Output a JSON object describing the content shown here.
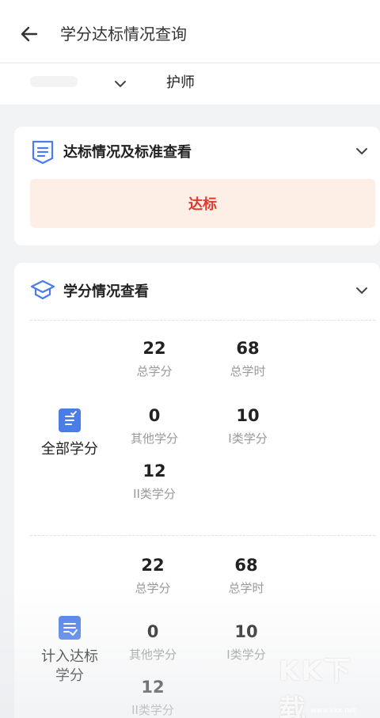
{
  "header": {
    "title": "学分达标情况查询"
  },
  "selector": {
    "value": "护师"
  },
  "standard_card": {
    "title": "达标情况及标准查看",
    "status": "达标",
    "status_color": "#e03a2f"
  },
  "credit_card": {
    "title": "学分情况查看",
    "sections": [
      {
        "label": "全部学分",
        "stats": [
          {
            "value": "22",
            "label": "总学分"
          },
          {
            "value": "68",
            "label": "总学时"
          },
          {
            "value": "0",
            "label": "其他学分"
          },
          {
            "value": "10",
            "label": "I类学分"
          },
          {
            "value": "12",
            "label": "II类学分"
          }
        ]
      },
      {
        "label_line1": "计入达标",
        "label_line2": "学分",
        "stats": [
          {
            "value": "22",
            "label": "总学分"
          },
          {
            "value": "68",
            "label": "总学时"
          },
          {
            "value": "0",
            "label": "其他学分"
          },
          {
            "value": "10",
            "label": "I类学分"
          },
          {
            "value": "12",
            "label": "II类学分"
          }
        ]
      }
    ]
  },
  "watermark": {
    "text": "KK下载",
    "url": "www.kkx.net"
  },
  "colors": {
    "accent": "#4a7de8",
    "status_bg": "#fdeee6"
  }
}
